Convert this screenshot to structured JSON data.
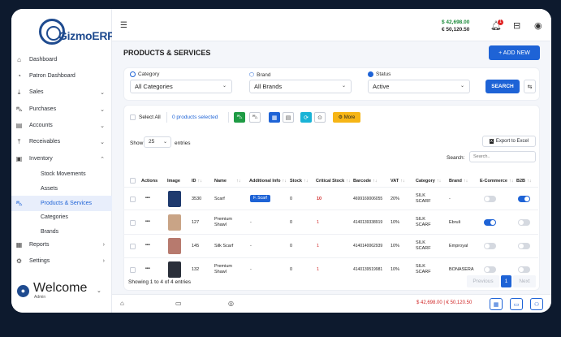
{
  "brand": {
    "name": "GizmoERP"
  },
  "sidebar": {
    "items": [
      {
        "label": "Dashboard",
        "icon": "home-icon"
      },
      {
        "label": "Patron Dashboard",
        "icon": "patron-dashboard-icon"
      },
      {
        "label": "Sales",
        "icon": "sales-icon",
        "expandable": true
      },
      {
        "label": "Purchases",
        "icon": "cart-icon",
        "expandable": true
      },
      {
        "label": "Accounts",
        "icon": "accounts-icon",
        "expandable": true
      },
      {
        "label": "Receivables",
        "icon": "receivables-icon",
        "expandable": true
      },
      {
        "label": "Inventory",
        "icon": "inventory-icon",
        "expanded": true
      },
      {
        "label": "Reports",
        "icon": "reports-icon",
        "expandable": true
      },
      {
        "label": "Settings",
        "icon": "gear-icon",
        "expandable": true
      }
    ],
    "inventory_sub": [
      "Stock Movements",
      "Assets",
      "Products & Services",
      "Categories",
      "Brands"
    ],
    "active_item": "Products & Services",
    "user": {
      "greeting": "Welcome",
      "role": "Admin"
    }
  },
  "topbar": {
    "balance_primary": "$ 42,698.00",
    "balance_secondary": "€ 50,120.50",
    "notification_count": "1"
  },
  "page": {
    "title": "PRODUCTS & SERVICES",
    "add_new_label": "+ ADD NEW"
  },
  "filters": {
    "category_label": "Category",
    "category_value": "All Categories",
    "brand_label": "Brand",
    "brand_value": "All Brands",
    "status_label": "Status",
    "status_value": "Active",
    "search_label": "SEARCH"
  },
  "toolbar": {
    "select_all": "Select All",
    "selected_count": "0 products selected",
    "more_label": "More"
  },
  "table_controls": {
    "show_label": "Show",
    "page_size": "25",
    "entries_label": "entries",
    "export_label": "Export to Excel",
    "search_label": "Search:",
    "search_placeholder": "Search.."
  },
  "table": {
    "headers": [
      "Actions",
      "Image",
      "ID",
      "Name",
      "Additional Info",
      "Stock",
      "Critical Stock",
      "Barcode",
      "VAT",
      "Category",
      "Brand",
      "E-Commerce",
      "B2B"
    ],
    "rows": [
      {
        "id": "3530",
        "name": "Scarf",
        "info": "F. Scarf",
        "stock": "0",
        "critical": "10",
        "barcode": "4699169006055",
        "vat": "20%",
        "category": "SILK SCARF",
        "brand": "-",
        "ecommerce": false,
        "b2b": true,
        "color": "#1e3a6e"
      },
      {
        "id": "127",
        "name": "Premium Shawl",
        "info": "-",
        "stock": "0",
        "critical": "1",
        "barcode": "4140139338919",
        "vat": "10%",
        "category": "SILK SCARF",
        "brand": "Ebruli",
        "ecommerce": true,
        "b2b": false,
        "color": "#c9a486"
      },
      {
        "id": "145",
        "name": "Silk Scarf",
        "info": "-",
        "stock": "0",
        "critical": "1",
        "barcode": "4140140062939",
        "vat": "10%",
        "category": "SILK SCARF",
        "brand": "Emproyal",
        "ecommerce": false,
        "b2b": false,
        "color": "#b77a6e"
      },
      {
        "id": "132",
        "name": "Premium Shawl",
        "info": "-",
        "stock": "0",
        "critical": "1",
        "barcode": "4140139519981",
        "vat": "10%",
        "category": "SILK SCARF",
        "brand": "BONASERA",
        "ecommerce": false,
        "b2b": false,
        "color": "#2a2f3a"
      }
    ],
    "summary": "Showing 1 to 4 of 4 entries"
  },
  "pagination": {
    "previous": "Previous",
    "current": "1",
    "next": "Next"
  },
  "footer": {
    "money": "$ 42,698.00  |  € 50,120.50"
  }
}
